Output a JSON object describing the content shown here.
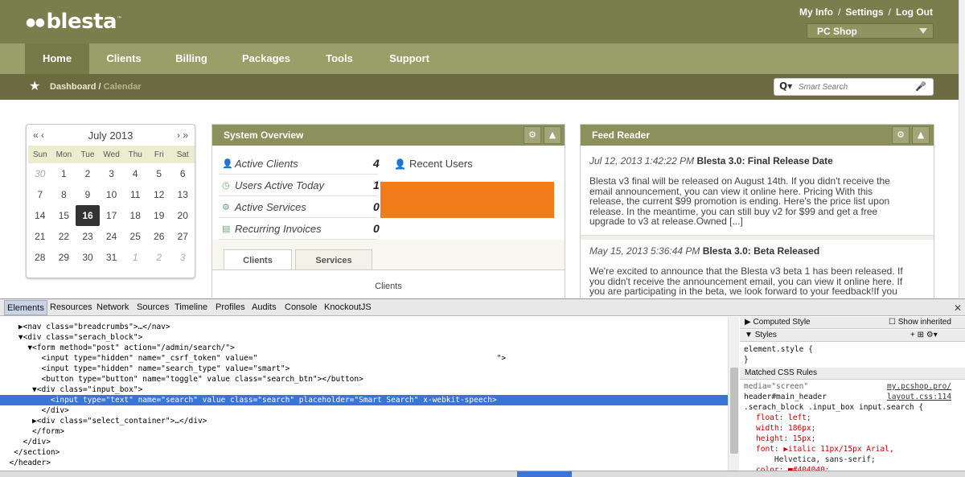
{
  "header": {
    "logo": "blesta",
    "links": [
      "My Info",
      "Settings",
      "Log Out"
    ],
    "company": "PC Shop"
  },
  "nav": [
    "Home",
    "Clients",
    "Billing",
    "Packages",
    "Tools",
    "Support"
  ],
  "breadcrumb": {
    "dashboard": "Dashboard",
    "calendar": "Calendar"
  },
  "search": {
    "placeholder": "Smart Search"
  },
  "calendar": {
    "month": "July 2013",
    "prev": "« ‹",
    "next": "› »",
    "days": [
      "Sun",
      "Mon",
      "Tue",
      "Wed",
      "Thu",
      "Fri",
      "Sat"
    ],
    "weeks": [
      [
        "30",
        "1",
        "2",
        "3",
        "4",
        "5",
        "6"
      ],
      [
        "7",
        "8",
        "9",
        "10",
        "11",
        "12",
        "13"
      ],
      [
        "14",
        "15",
        "16",
        "17",
        "18",
        "19",
        "20"
      ],
      [
        "21",
        "22",
        "23",
        "24",
        "25",
        "26",
        "27"
      ],
      [
        "28",
        "29",
        "30",
        "31",
        "1",
        "2",
        "3"
      ]
    ],
    "today": "16"
  },
  "system_overview": {
    "title": "System Overview",
    "rows": [
      {
        "label": "Active Clients",
        "value": "4"
      },
      {
        "label": "Users Active Today",
        "value": "1"
      },
      {
        "label": "Active Services",
        "value": "0"
      },
      {
        "label": "Recurring Invoices",
        "value": "0"
      }
    ],
    "recent_users": "Recent Users",
    "tabs": [
      "Clients",
      "Services"
    ],
    "chart_title": "Clients"
  },
  "feed": {
    "title": "Feed Reader",
    "items": [
      {
        "date": "Jul 12, 2013 1:42:22 PM",
        "title": "Blesta 3.0: Final Release Date",
        "lines": [
          "Blesta v3 final will be released on August 14th. If you didn't receive the",
          "email announcement, you can view it online here.  Pricing With this",
          "release, the current $99 promotion is ending. Here's the price list upon",
          "release. In the meantime, you can still buy v2 for $99 and get a free",
          "upgrade to v3 at release.Owned [...]"
        ]
      },
      {
        "date": "May 15, 2013 5:36:44 PM",
        "title": "Blesta 3.0: Beta Released",
        "lines": [
          "We're excited to announce that the Blesta v3 beta 1 has been released. If",
          "you didn't receive the announcement email, you can view it online here.  If",
          "you are participating in the beta, we look forward to your feedback!If you"
        ]
      }
    ]
  },
  "devtools": {
    "tabs": [
      "Elements",
      "Resources",
      "Network",
      "Sources",
      "Timeline",
      "Profiles",
      "Audits",
      "Console",
      "KnockoutJS"
    ],
    "lines": [
      "    ▶<nav class=\"breadcrumbs\">…</nav>",
      "    ▼<div class=\"serach_block\">",
      "      ▼<form method=\"post\" action=\"/admin/search/\">",
      "         <input type=\"hidden\" name=\"_csrf_token\" value=\"                                                    \">",
      "         <input type=\"hidden\" name=\"search_type\" value=\"smart\">",
      "         <button type=\"button\" name=\"toggle\" value class=\"search_btn\"></button>",
      "       ▼<div class=\"input_box\">",
      "           <input type=\"text\" name=\"search\" value class=\"search\" placeholder=\"Smart Search\" x-webkit-speech>",
      "         </div>",
      "       ▶<div class=\"select_container\">…</div>",
      "       </form>",
      "     </div>",
      "   </section>",
      "  </header>"
    ],
    "side": {
      "computed": "Computed Style",
      "show_inherited": "Show inherited",
      "styles": "Styles",
      "element_style": "element.style {",
      "close_brace": "}",
      "matched": "Matched CSS Rules",
      "media": "media=\"screen\"",
      "source1": "my.pcshop.pro/",
      "selector1": "header#main_header",
      "source2": "layout.css:114",
      "selector2": ".serach_block .input_box input.search {",
      "props": [
        "float: left;",
        "width: 186px;",
        "height: 15px;",
        "font: ▶italic 11px/15px Arial,",
        "    Helvetica, sans-serif;",
        "color: ■#404040;"
      ]
    }
  },
  "colors": {
    "header": "#7a7e4c",
    "nav": "#9a9e68",
    "breadcrumb": "#6b6a40",
    "redaction": "#f07d1a",
    "selection": "#3875d7"
  }
}
